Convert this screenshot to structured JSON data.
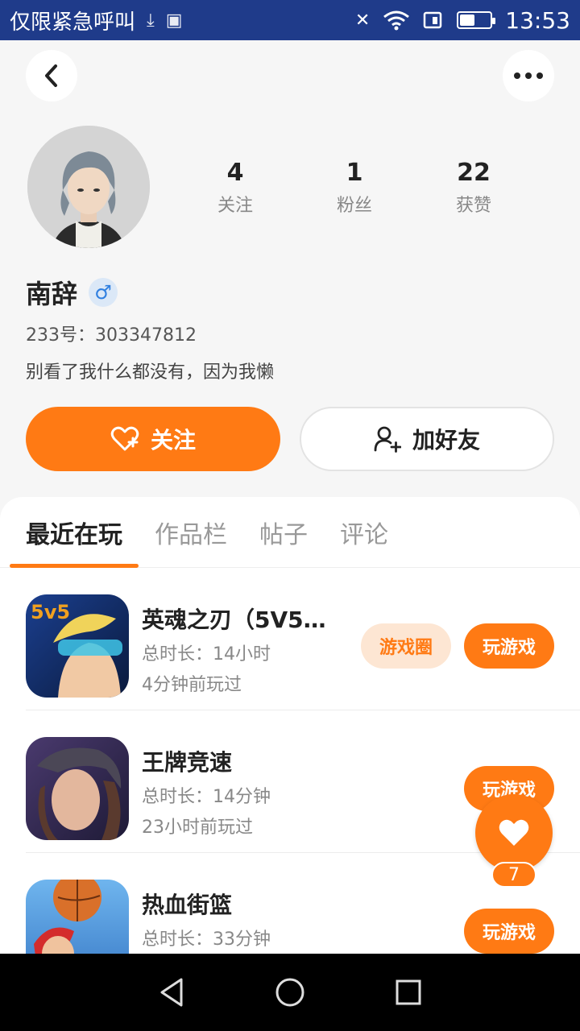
{
  "status_bar": {
    "carrier": "仅限紧急呼叫",
    "time": "13:53",
    "battery_level": 0.55
  },
  "profile": {
    "name": "南辞",
    "gender_symbol": "♂",
    "uid": "233号：303347812",
    "bio": "别看了我什么都没有，因为我懒",
    "stats": [
      {
        "value": "4",
        "label": "关注"
      },
      {
        "value": "1",
        "label": "粉丝"
      },
      {
        "value": "22",
        "label": "获赞"
      }
    ]
  },
  "actions": {
    "follow": "关注",
    "add_friend": "加好友"
  },
  "tabs": [
    "最近在玩",
    "作品栏",
    "帖子",
    "评论"
  ],
  "games": [
    {
      "name": "英魂之刃（5V5英…",
      "duration": "总时长：14小时",
      "last_played": "4分钟前玩过",
      "circle": "游戏圈",
      "play": "玩游戏"
    },
    {
      "name": "王牌竞速",
      "duration": "总时长：14分钟",
      "last_played": "23小时前玩过",
      "play": "玩游戏"
    },
    {
      "name": "热血街篮",
      "duration": "总时长：33分钟",
      "play": "玩游戏"
    }
  ],
  "like_fab": {
    "count": "7"
  },
  "colors": {
    "accent": "#ff7a14",
    "status_bar": "#1f3b8a"
  }
}
